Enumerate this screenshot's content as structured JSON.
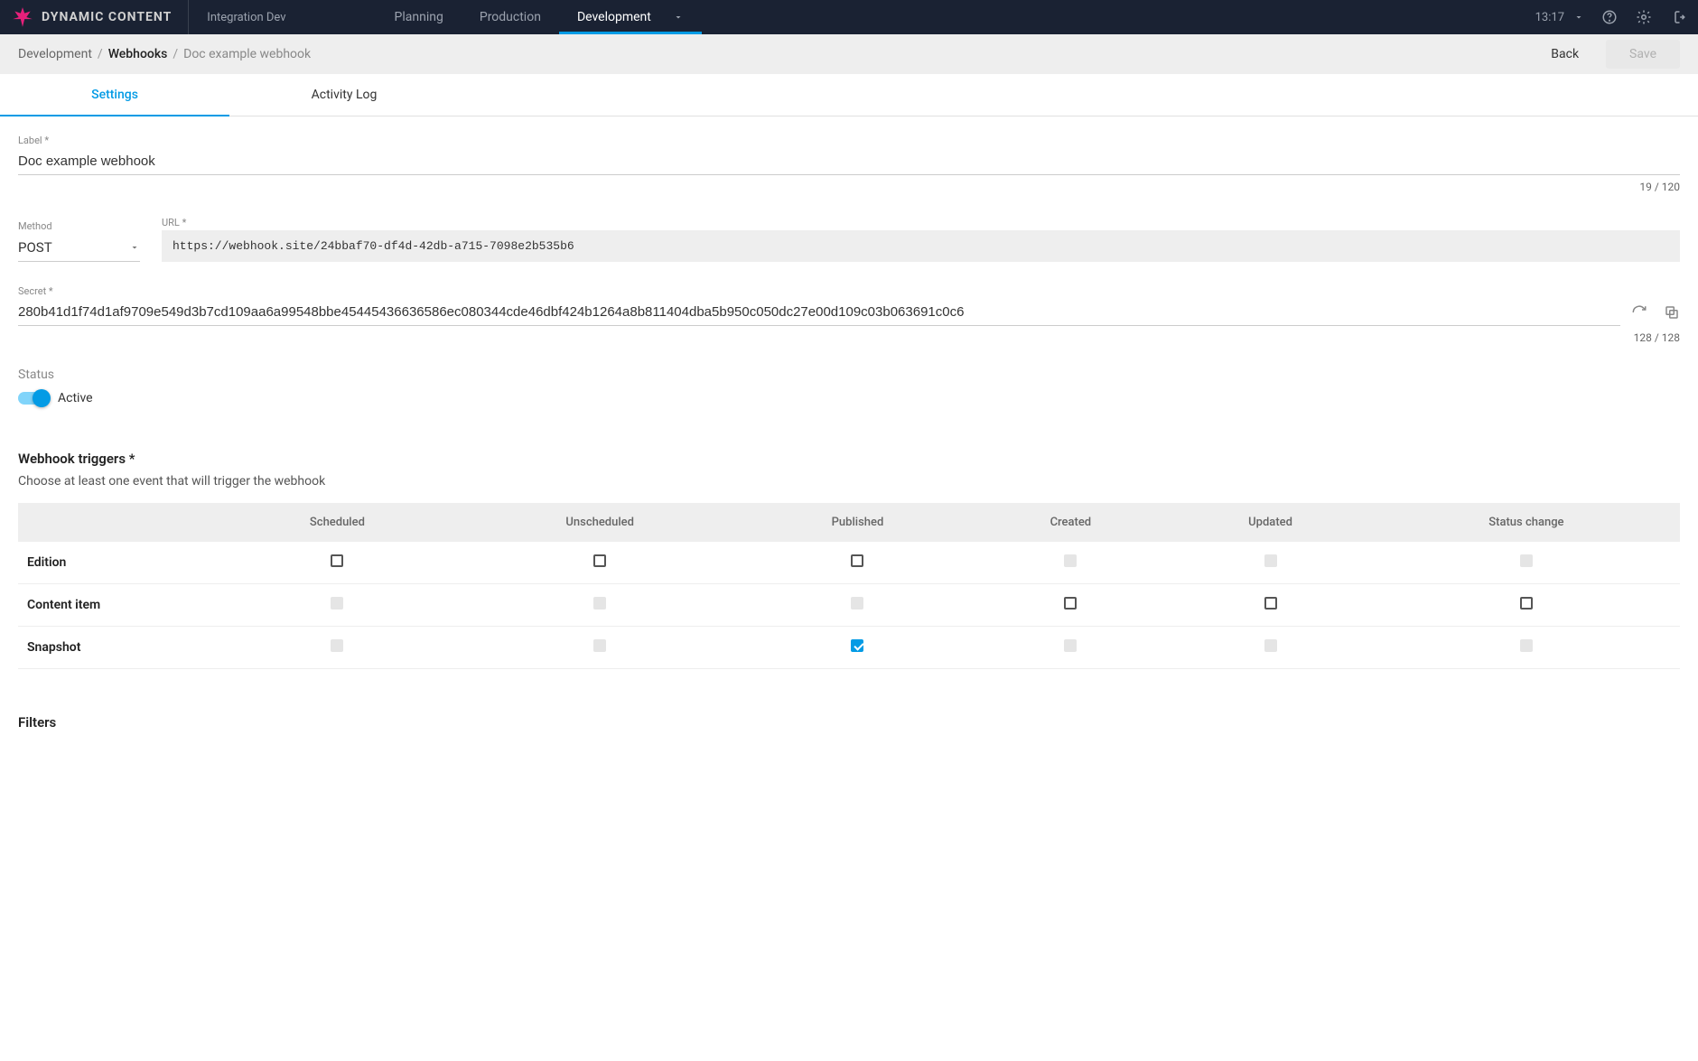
{
  "header": {
    "brand": "DYNAMIC CONTENT",
    "org": "Integration Dev",
    "tabs": [
      "Planning",
      "Production",
      "Development"
    ],
    "active_tab": 2,
    "time": "13:17"
  },
  "breadcrumb": {
    "items": [
      "Development",
      "Webhooks",
      "Doc example webhook"
    ],
    "back_label": "Back",
    "save_label": "Save"
  },
  "subtabs": {
    "items": [
      "Settings",
      "Activity Log"
    ],
    "active": 0
  },
  "form": {
    "label_field": {
      "label": "Label *",
      "value": "Doc example webhook",
      "counter": "19 / 120"
    },
    "method_field": {
      "label": "Method",
      "value": "POST"
    },
    "url_field": {
      "label": "URL *",
      "value": "https://webhook.site/24bbaf70-df4d-42db-a715-7098e2b535b6"
    },
    "secret_field": {
      "label": "Secret *",
      "value": "280b41d1f74d1af9709e549d3b7cd109aa6a99548bbe45445436636586ec080344cde46dbf424b1264a8b811404dba5b950c050dc27e00d109c03b063691c0c6",
      "counter": "128 / 128"
    },
    "status": {
      "label": "Status",
      "value_text": "Active",
      "active": true
    }
  },
  "triggers": {
    "title": "Webhook triggers *",
    "description": "Choose at least one event that will trigger the webhook",
    "columns": [
      "Scheduled",
      "Unscheduled",
      "Published",
      "Created",
      "Updated",
      "Status change"
    ],
    "rows": [
      {
        "label": "Edition",
        "cells": [
          "unchecked",
          "unchecked",
          "unchecked",
          "disabled",
          "disabled",
          "disabled"
        ]
      },
      {
        "label": "Content item",
        "cells": [
          "disabled",
          "disabled",
          "disabled",
          "unchecked",
          "unchecked",
          "unchecked"
        ]
      },
      {
        "label": "Snapshot",
        "cells": [
          "disabled",
          "disabled",
          "checked",
          "disabled",
          "disabled",
          "disabled"
        ]
      }
    ]
  },
  "filters": {
    "title": "Filters"
  },
  "icons": {
    "logo_color": "#e6207b"
  }
}
